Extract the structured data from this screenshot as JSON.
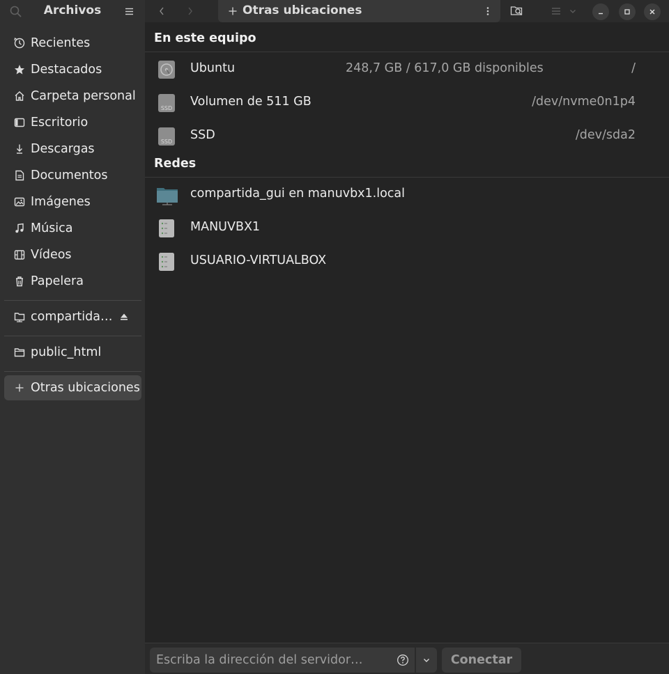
{
  "app": {
    "title": "Archivos"
  },
  "header": {
    "path_label": "Otras ubicaciones",
    "path_icon": "plus-icon"
  },
  "sidebar": {
    "items": [
      {
        "label": "Recientes",
        "icon": "clock-icon"
      },
      {
        "label": "Destacados",
        "icon": "star-icon"
      },
      {
        "label": "Carpeta personal",
        "icon": "home-icon"
      },
      {
        "label": "Escritorio",
        "icon": "desktop-icon"
      },
      {
        "label": "Descargas",
        "icon": "download-icon"
      },
      {
        "label": "Documentos",
        "icon": "document-icon"
      },
      {
        "label": "Imágenes",
        "icon": "image-icon"
      },
      {
        "label": "Música",
        "icon": "music-icon"
      },
      {
        "label": "Vídeos",
        "icon": "video-icon"
      },
      {
        "label": "Papelera",
        "icon": "trash-icon"
      }
    ],
    "mounts": [
      {
        "label": "compartida…",
        "icon": "network-folder-icon"
      }
    ],
    "bookmarks": [
      {
        "label": "public_html",
        "icon": "folder-icon"
      }
    ],
    "other_locations": {
      "label": "Otras ubicaciones",
      "icon": "plus-icon"
    }
  },
  "main": {
    "sections": [
      {
        "title": "En este equipo",
        "rows": [
          {
            "name": "Ubuntu",
            "info": "248,7 GB / 617,0 GB disponibles",
            "path": "/",
            "icon": "hard-disk-icon"
          },
          {
            "name": "Volumen de 511 GB",
            "info": "",
            "path": "/dev/nvme0n1p4",
            "icon": "ssd-icon"
          },
          {
            "name": "SSD",
            "info": "",
            "path": "/dev/sda2",
            "icon": "ssd-icon"
          }
        ]
      },
      {
        "title": "Redes",
        "rows": [
          {
            "name": "compartida_gui en manuvbx1.local",
            "icon": "network-folder-icon"
          },
          {
            "name": "MANUVBX1",
            "icon": "server-icon"
          },
          {
            "name": "USUARIO-VIRTUALBOX",
            "icon": "server-icon"
          }
        ]
      }
    ]
  },
  "bottom": {
    "server_placeholder": "Escriba la dirección del servidor…",
    "server_value": "",
    "connect_label": "Conectar"
  },
  "colors": {
    "sidebar_bg": "#303030",
    "main_bg": "#242424",
    "selected_bg": "#464646",
    "secondary_text": "#a6a6a6",
    "folder_teal": "#4a7d8c"
  }
}
